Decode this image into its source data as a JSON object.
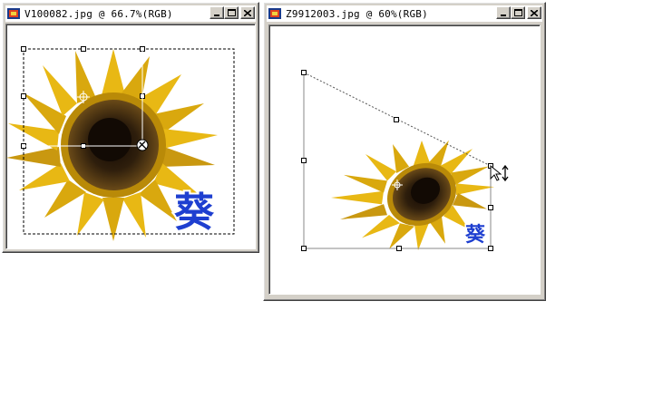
{
  "windows": [
    {
      "title": "V100082.jpg @ 66.7%(RGB)",
      "buttons": [
        "minimize",
        "maximize",
        "close"
      ]
    },
    {
      "title": "Z9912003.jpg @ 60%(RGB)",
      "buttons": [
        "minimize",
        "maximize",
        "close"
      ]
    }
  ],
  "image_text": {
    "left_char": "葵",
    "right_char": "葵"
  },
  "icons": {
    "app": "photoshop-document-icon",
    "cursor_left": "scissors-transform-cursor-icon",
    "cursor_right": "arrow-resize-cursor-icon"
  },
  "colors": {
    "petal": "#e8b814",
    "petal_dark": "#b98a08",
    "center": "#3b2a10",
    "center_dark": "#1a1008",
    "char_blue": "#1e3fd0"
  }
}
